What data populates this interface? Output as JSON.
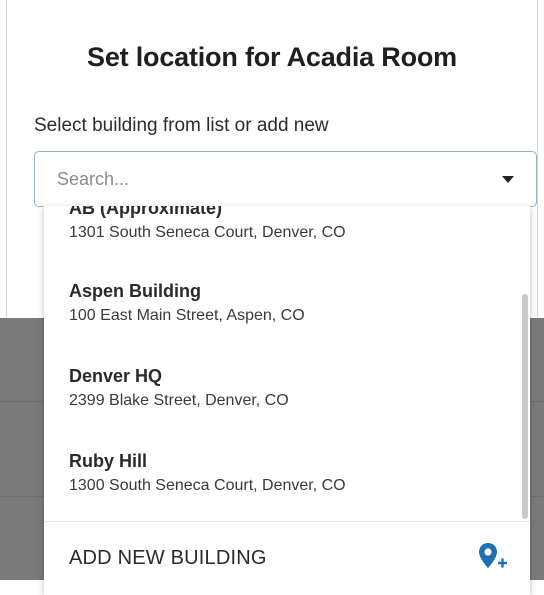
{
  "modal": {
    "title": "Set location for Acadia Room",
    "field_label": "Select building from list or add new",
    "search_placeholder": "Search...",
    "caret_icon": "caret-down-icon"
  },
  "dropdown": {
    "options": [
      {
        "name": "AB (Approximate)",
        "address": "1301 South Seneca Court, Denver, CO"
      },
      {
        "name": "Aspen Building",
        "address": "100 East Main Street, Aspen, CO"
      },
      {
        "name": "Denver HQ",
        "address": "2399 Blake Street, Denver, CO"
      },
      {
        "name": "Ruby Hill",
        "address": "1300 South Seneca Court, Denver, CO"
      }
    ],
    "add_new_label": "ADD NEW BUILDING",
    "add_icon": "add-location-pin-icon"
  },
  "colors": {
    "accent": "#1f6fb3",
    "input_border": "#8fb3c9",
    "overlay": "#7a7a7a"
  }
}
